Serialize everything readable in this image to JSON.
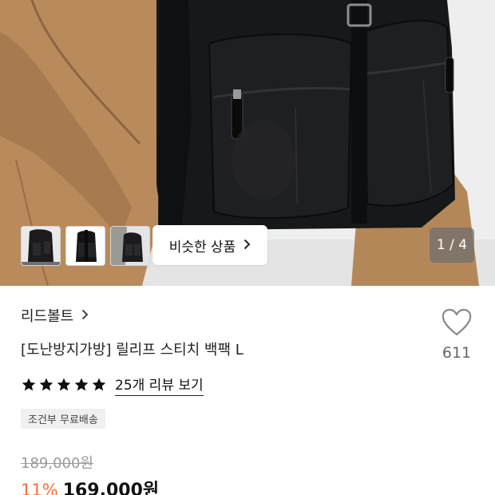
{
  "gallery": {
    "similar_button_label": "비슷한 상품",
    "counter": "1 / 4",
    "current_index": 1,
    "total": 4,
    "thumbnails": [
      "backpack-worn-front",
      "backpack-product",
      "backpack-worn-back"
    ]
  },
  "product": {
    "brand": "리드볼트",
    "title": "[도난방지가방] 릴리프 스티치 백팩 L",
    "like_count": "611",
    "rating_stars": 5,
    "review_link": "25개 리뷰 보기",
    "shipping_badge": "조건부 무료배송",
    "original_price": "189,000원",
    "discount_rate": "11%",
    "sale_price": "169,000원"
  },
  "colors": {
    "discount": "#ff6b3d",
    "star": "#111111",
    "badge_bg": "#f0f0f0",
    "original_price": "#9a9a9a"
  },
  "icons": {
    "brand_chevron": "chevron-right-icon",
    "similar_chevron": "chevron-right-icon",
    "like": "heart-outline-icon",
    "star": "star-filled-icon"
  }
}
